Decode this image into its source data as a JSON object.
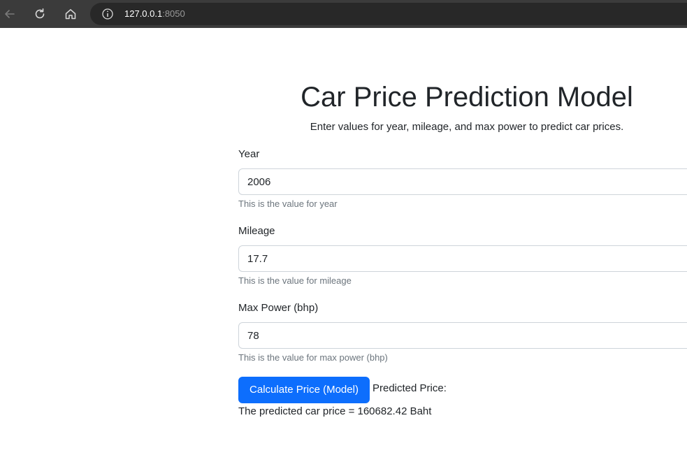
{
  "browser": {
    "url_host": "127.0.0.1",
    "url_port": ":8050",
    "icons": {
      "back": "arrow-left-icon",
      "reload": "reload-icon",
      "home": "home-icon",
      "site_info": "info-icon"
    }
  },
  "page": {
    "title": "Car Price Prediction Model",
    "subtitle": "Enter values for year, mileage, and max power to predict car prices."
  },
  "form": {
    "year": {
      "label": "Year",
      "value": "2006",
      "help": "This is the value for year"
    },
    "mileage": {
      "label": "Mileage",
      "value": "17.7",
      "help": "This is the value for mileage"
    },
    "max_power": {
      "label": "Max Power (bhp)",
      "value": "78",
      "help": "This is the value for max power (bhp)"
    },
    "submit_label": "Calculate Price (Model)",
    "predicted_label": "Predicted Price:",
    "result": "The predicted car price = 160682.42 Baht"
  },
  "colors": {
    "primary": "#0d6efd",
    "browser_chrome": "#3b3b3b",
    "address_bar": "#282828",
    "help_text": "#6c757d"
  }
}
